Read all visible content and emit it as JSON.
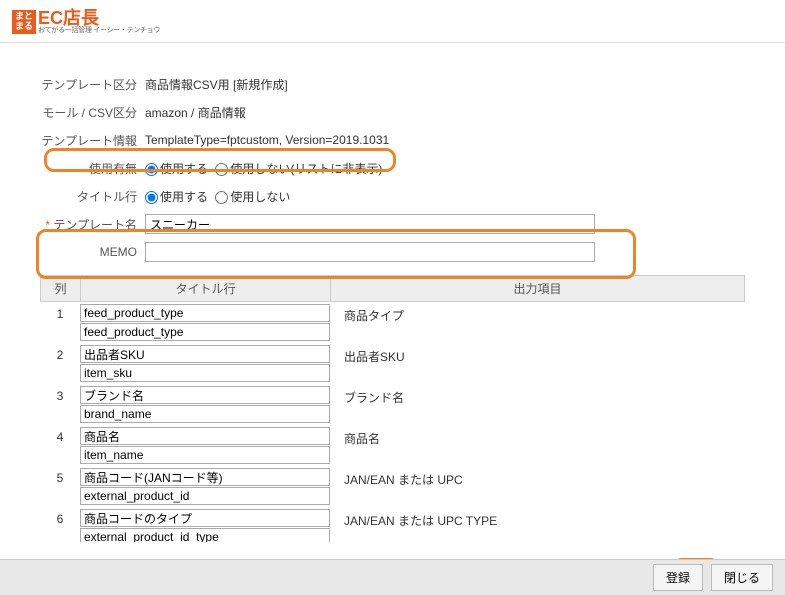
{
  "logo": {
    "box_line1": "まと",
    "box_line2": "まる",
    "main_ec": "EC",
    "main_tencho": "店長",
    "sub": "おてがる一括管理 イーシー・テンチョウ"
  },
  "form": {
    "template_kubun_label": "テンプレート区分",
    "template_kubun_value": "商品情報CSV用 [新規作成]",
    "mall_csv_label": "モール / CSV区分",
    "mall_csv_value": "amazon / 商品情報",
    "template_info_label": "テンプレート情報",
    "template_info_value": "TemplateType=fptcustom, Version=2019.1031",
    "use_flag_label": "使用有無",
    "use_flag_opt1": "使用する",
    "use_flag_opt2": "使用しない(リストに非表示)",
    "title_row_label": "タイトル行",
    "title_row_opt1": "使用する",
    "title_row_opt2": "使用しない",
    "template_name_label": "テンプレート名",
    "template_name_value": "スニーカー",
    "memo_label": "MEMO",
    "memo_value": ""
  },
  "table": {
    "header_col": "列",
    "header_title": "タイトル行",
    "header_output": "出力項目",
    "rows": [
      {
        "num": "1",
        "title1": "feed_product_type",
        "title2": "feed_product_type",
        "output": "商品タイプ"
      },
      {
        "num": "2",
        "title1": "出品者SKU",
        "title2": "item_sku",
        "output": "出品者SKU"
      },
      {
        "num": "3",
        "title1": "ブランド名",
        "title2": "brand_name",
        "output": "ブランド名"
      },
      {
        "num": "4",
        "title1": "商品名",
        "title2": "item_name",
        "output": "商品名"
      },
      {
        "num": "5",
        "title1": "商品コード(JANコード等)",
        "title2": "external_product_id",
        "output": "JAN/EAN または UPC"
      },
      {
        "num": "6",
        "title1": "商品コードのタイプ",
        "title2": "external_product_id_type",
        "output": "JAN/EAN または UPC TYPE"
      }
    ]
  },
  "footer": {
    "register": "登録",
    "close": "閉じる"
  }
}
